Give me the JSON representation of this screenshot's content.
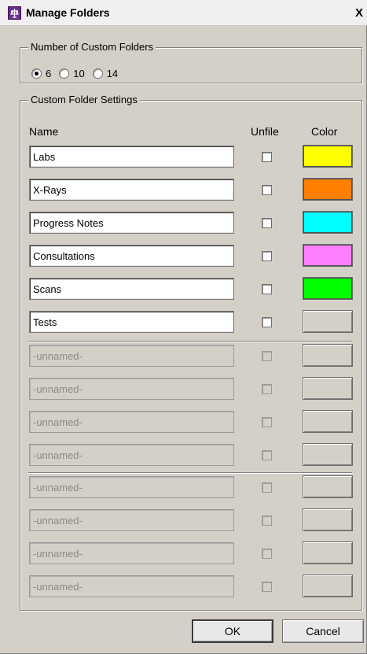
{
  "window": {
    "title": "Manage Folders",
    "close_symbol": "X"
  },
  "number_group": {
    "legend": "Number of Custom Folders",
    "options": [
      {
        "label": "6",
        "checked": true
      },
      {
        "label": "10",
        "checked": false
      },
      {
        "label": "14",
        "checked": false
      }
    ]
  },
  "settings_group": {
    "legend": "Custom Folder Settings",
    "columns": {
      "name": "Name",
      "unfile": "Unfile",
      "color": "Color"
    },
    "folders": [
      {
        "name": "Labs",
        "enabled": true,
        "unfile": false,
        "color": "#ffff00"
      },
      {
        "name": "X-Rays",
        "enabled": true,
        "unfile": false,
        "color": "#ff8000"
      },
      {
        "name": "Progress Notes",
        "enabled": true,
        "unfile": false,
        "color": "#00ffff"
      },
      {
        "name": "Consultations",
        "enabled": true,
        "unfile": false,
        "color": "#ff80ff"
      },
      {
        "name": "Scans",
        "enabled": true,
        "unfile": false,
        "color": "#00ff00"
      },
      {
        "name": "Tests",
        "enabled": true,
        "unfile": false,
        "color": ""
      },
      {
        "name": "-unnamed-",
        "enabled": false,
        "unfile": false,
        "color": ""
      },
      {
        "name": "-unnamed-",
        "enabled": false,
        "unfile": false,
        "color": ""
      },
      {
        "name": "-unnamed-",
        "enabled": false,
        "unfile": false,
        "color": ""
      },
      {
        "name": "-unnamed-",
        "enabled": false,
        "unfile": false,
        "color": ""
      },
      {
        "name": "-unnamed-",
        "enabled": false,
        "unfile": false,
        "color": ""
      },
      {
        "name": "-unnamed-",
        "enabled": false,
        "unfile": false,
        "color": ""
      },
      {
        "name": "-unnamed-",
        "enabled": false,
        "unfile": false,
        "color": ""
      },
      {
        "name": "-unnamed-",
        "enabled": false,
        "unfile": false,
        "color": ""
      }
    ]
  },
  "buttons": {
    "ok": "OK",
    "cancel": "Cancel"
  }
}
